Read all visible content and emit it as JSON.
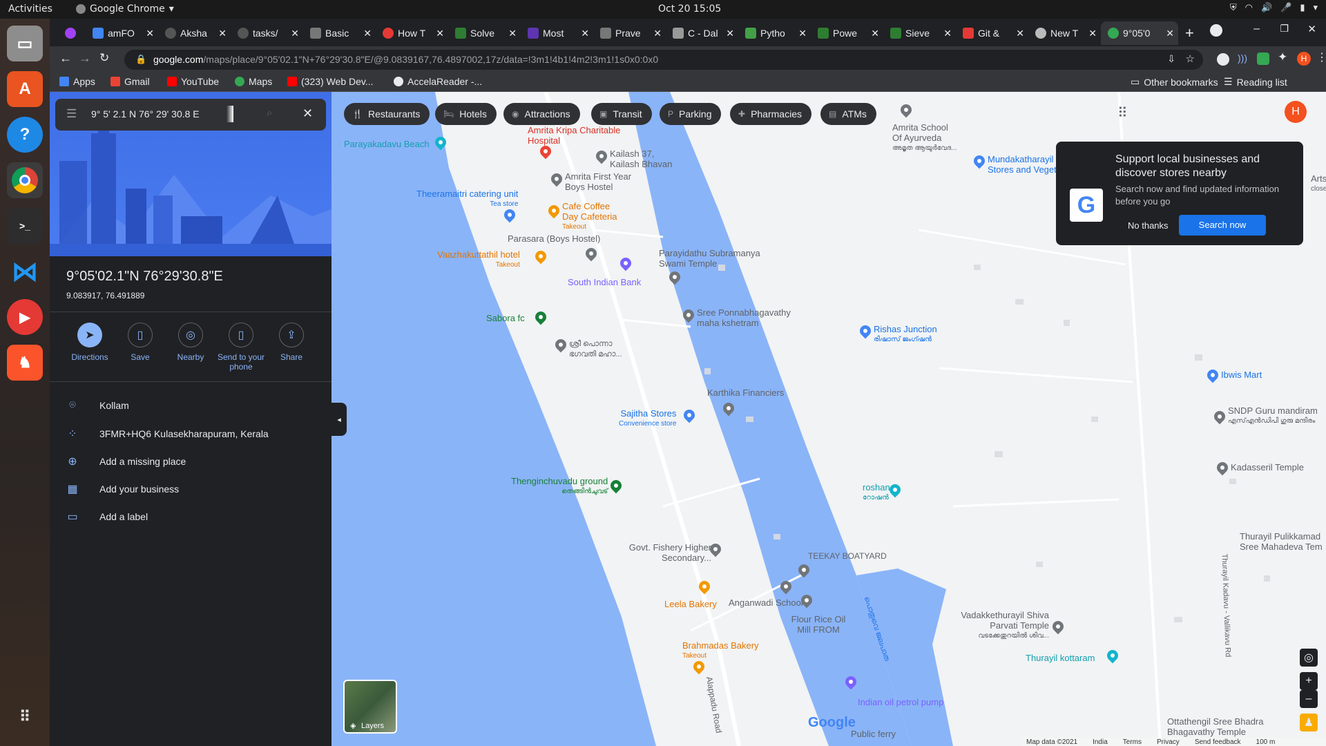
{
  "os": {
    "activities": "Activities",
    "app_name": "Google Chrome",
    "clock": "Oct 20  15:05"
  },
  "tabs": [
    {
      "label": "",
      "color": "#a142f4"
    },
    {
      "label": "amFO",
      "color": "#4285f4"
    },
    {
      "label": "Aksha",
      "color": "#555"
    },
    {
      "label": "tasks/",
      "color": "#555"
    },
    {
      "label": "Basic",
      "color": "#777"
    },
    {
      "label": "How T",
      "color": "#e53935"
    },
    {
      "label": "Solve",
      "color": "#2e7d32"
    },
    {
      "label": "Most",
      "color": "#5e35b1"
    },
    {
      "label": "Prave",
      "color": "#777"
    },
    {
      "label": "C - Dal",
      "color": "#999"
    },
    {
      "label": "Pytho",
      "color": "#43a047"
    },
    {
      "label": "Powe",
      "color": "#2e7d32"
    },
    {
      "label": "Sieve",
      "color": "#2e7d32"
    },
    {
      "label": "Git & ",
      "color": "#e53935"
    },
    {
      "label": "New T",
      "color": "#bbb"
    },
    {
      "label": "9°05'0",
      "color": "#34a853"
    }
  ],
  "omnibox": {
    "host": "google.com",
    "path": "/maps/place/9°05'02.1\"N+76°29'30.8\"E/@9.0839167,76.4897002,17z/data=!3m1!4b1!4m2!3m1!1s0x0:0x0"
  },
  "bookmarks": [
    {
      "label": "Apps",
      "color": "#4285f4"
    },
    {
      "label": "Gmail",
      "color": "#ea4335"
    },
    {
      "label": "YouTube",
      "color": "#ff0000"
    },
    {
      "label": "Maps",
      "color": "#34a853"
    },
    {
      "label": "(323) Web Dev...",
      "color": "#ff0000"
    },
    {
      "label": "AccelaReader -...",
      "color": "#e8eaed"
    }
  ],
  "bookmarks_right": {
    "other": "Other bookmarks",
    "reading": "Reading list"
  },
  "panel": {
    "search_value": "9° 5' 2.1 N 76° 29' 30.8 E",
    "title": "9°05'02.1\"N 76°29'30.8\"E",
    "subtitle": "9.083917, 76.491889",
    "actions": [
      "Directions",
      "Save",
      "Nearby",
      "Send to your phone",
      "Share"
    ],
    "info": [
      "Kollam",
      "3FMR+HQ6 Kulasekharapuram, Kerala",
      "Add a missing place",
      "Add your business",
      "Add a label"
    ]
  },
  "chips": [
    "Restaurants",
    "Hotels",
    "Attractions",
    "Transit",
    "Parking",
    "Pharmacies",
    "ATMs"
  ],
  "promo": {
    "title": "Support local businesses and discover stores nearby",
    "body": "Search now and find updated information before you go",
    "no_thanks": "No thanks",
    "search_now": "Search now"
  },
  "avatar_letter": "H",
  "layers_label": "Layers",
  "google_logo": "Google",
  "footer": [
    "Map data ©2021",
    "India",
    "Terms",
    "Privacy",
    "Send feedback",
    "100 m"
  ],
  "pois": {
    "amrita_kripa": "Amrita Kripa Charitable Hospital",
    "kailash": "Kailash 37, Kailash Bhavan",
    "amrita_school": "Amrita School Of Ayurveda",
    "amrita_school_sub": "അമൃത ആയുർവേദ...",
    "mundakatharayil": "Mundakatharayil Stores and Veget",
    "parayakadavu": "Parayakadavu Beach",
    "first_year": "Amrita First Year Boys Hostel",
    "theeramaitri": "Theeramaitri catering unit",
    "theeramaitri_sub": "Tea store",
    "cafe_coffee": "Cafe Coffee Day Cafeteria",
    "cafe_coffee_sub": "Takeout",
    "parasara": "Parasara (Boys Hostel)",
    "vaazhakuttathil": "Vaazhakuttathil hotel",
    "vaazhakuttathil_sub": "Takeout",
    "parayidathu": "Parayidathu Subramanya Swami Temple",
    "south_indian_bank": "South Indian Bank",
    "sabora": "Sabora fc",
    "ponnabhagavathy": "Sree Ponnabhagavathy maha kshetram",
    "malayalam_temple": "ശ്രീ പൊന്നാ ഭഗവതി മഹാ...",
    "rishas": "Rishas Junction",
    "rishas_sub": "രിഷാസ് ജംഗ്ഷൻ",
    "ibwis": "Ibwis Mart",
    "sndp": "SNDP Guru mandiram",
    "sndp_sub": "എസ്എൻഡിപി ഗുരു മന്ദിരം",
    "karthika": "Karthika Financiers",
    "sajitha": "Sajitha Stores",
    "sajitha_sub": "Convenience store",
    "kadasseril": "Kadasseril Temple",
    "thenginchuvadu": "Thenginchuvadu ground",
    "thenginchuvadu_sub": "തെങ്ങിൻചുവട്",
    "roshan": "roshan",
    "roshan_sub": "റോഷൻ",
    "fishery": "Govt. Fishery Higher Secondary...",
    "teekay": "TEEKAY BOATYARD",
    "thurayil_pulikkamad": "Thurayil Pulikkamad Sree Mahadeva Tem",
    "leela": "Leela Bakery",
    "anganwadi": "Anganwadi School",
    "flour": "Flour Rice Oil Mill FROM",
    "vadakkethurayil": "Vadakkethurayil Shiva Parvati Temple",
    "vadakkethurayil_sub": "വടക്കേതുറയിൽ ശിവ...",
    "thurayil_kottaram": "Thurayil kottaram",
    "brahmadas": "Brahmadas Bakery",
    "brahmadas_sub": "Takeout",
    "indian_oil": "Indian oil petrol pump",
    "ottathengil": "Ottathengil Sree Bhadra Bhagavathy Temple",
    "public_ferry": "Public ferry",
    "alappadu_road": "Alappadu Road",
    "thurayil_road": "Thurayil Kadavu - Vallikavu Rd",
    "canal_label": "പൊതുവെ ജലപാത",
    "arts": "Arts",
    "arts_sub": "closed"
  }
}
